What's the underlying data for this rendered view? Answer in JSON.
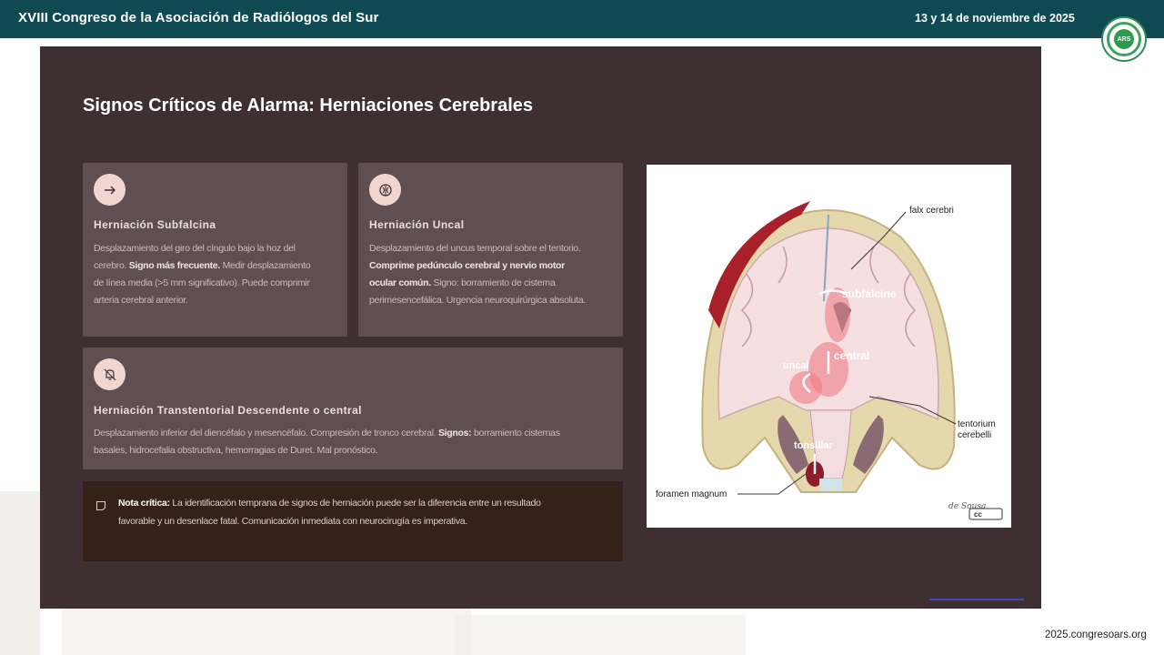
{
  "header": {
    "title": "XVIII Congreso de la Asociación de Radiólogos del Sur",
    "date": "13 y 14 de noviembre de 2025",
    "logo_text": "ARS"
  },
  "slide": {
    "title": "Signos Críticos de Alarma: Herniaciones Cerebrales",
    "cards": [
      {
        "icon": "arrow-right-icon",
        "title": "Herniación Subfalcina",
        "lines": [
          {
            "pre": "Desplazamiento del giro del cíngulo bajo la hoz del",
            "bold": "",
            "post": ""
          },
          {
            "pre": "cerebro. ",
            "bold": "Signo más frecuente.",
            "post": " Medir desplazamiento"
          },
          {
            "pre": "de línea media (>5 mm significativo). Puede comprimir",
            "bold": "",
            "post": ""
          },
          {
            "pre": "arteria cerebral anterior.",
            "bold": "",
            "post": ""
          }
        ]
      },
      {
        "icon": "brain-icon",
        "title": "Herniación Uncal",
        "lines": [
          {
            "pre": "Desplazamiento del uncus temporal sobre el tentorio.",
            "bold": "",
            "post": ""
          },
          {
            "pre": "",
            "bold": "Comprime pedúnculo cerebral y nervio motor",
            "post": ""
          },
          {
            "pre": "",
            "bold": "ocular común.",
            "post": " Signo: borramiento de cisterna"
          },
          {
            "pre": "perimesencefálica. Urgencia neuroquirúrgica absoluta.",
            "bold": "",
            "post": ""
          }
        ]
      },
      {
        "icon": "bell-off-icon",
        "title": "Herniación Transtentorial Descendente o central",
        "lines": [
          {
            "pre": "Desplazamiento inferior del diencéfalo y mesencéfalo. Compresión de tronco cerebral. ",
            "bold": "Signos:",
            "post": " borramiento cisternas"
          },
          {
            "pre": "basales, hidrocefalia obstructiva, hemorragias de Duret. Mal pronóstico.",
            "bold": "",
            "post": ""
          }
        ]
      }
    ],
    "note": {
      "lines": [
        {
          "pre": "",
          "bold": "Nota crítica:",
          "post": " La identificación temprana de signos de herniación puede ser la diferencia entre un resultado"
        },
        {
          "pre": "favorable y un desenlace fatal. Comunicación inmediata con neurocirugía es imperativa.",
          "bold": "",
          "post": ""
        }
      ]
    },
    "diagram_labels": {
      "falx": "falx cerebri",
      "subfalcine": "subfalcine",
      "central": "central",
      "uncal": "uncal",
      "tentorium1": "tentorium",
      "tentorium2": "cerebelli",
      "tonsillar": "tonsillar",
      "foramen": "foramen magnum",
      "signature": "de Sousa",
      "license": "cc"
    }
  },
  "footer": {
    "url": "2025.congresoars.org"
  },
  "colors": {
    "header_bg": "#0f4a52",
    "slide_bg": "#3e2f33",
    "card_bg": "#5f4f53",
    "note_bg": "#36201a",
    "icon_bg": "#f1d6cf"
  }
}
